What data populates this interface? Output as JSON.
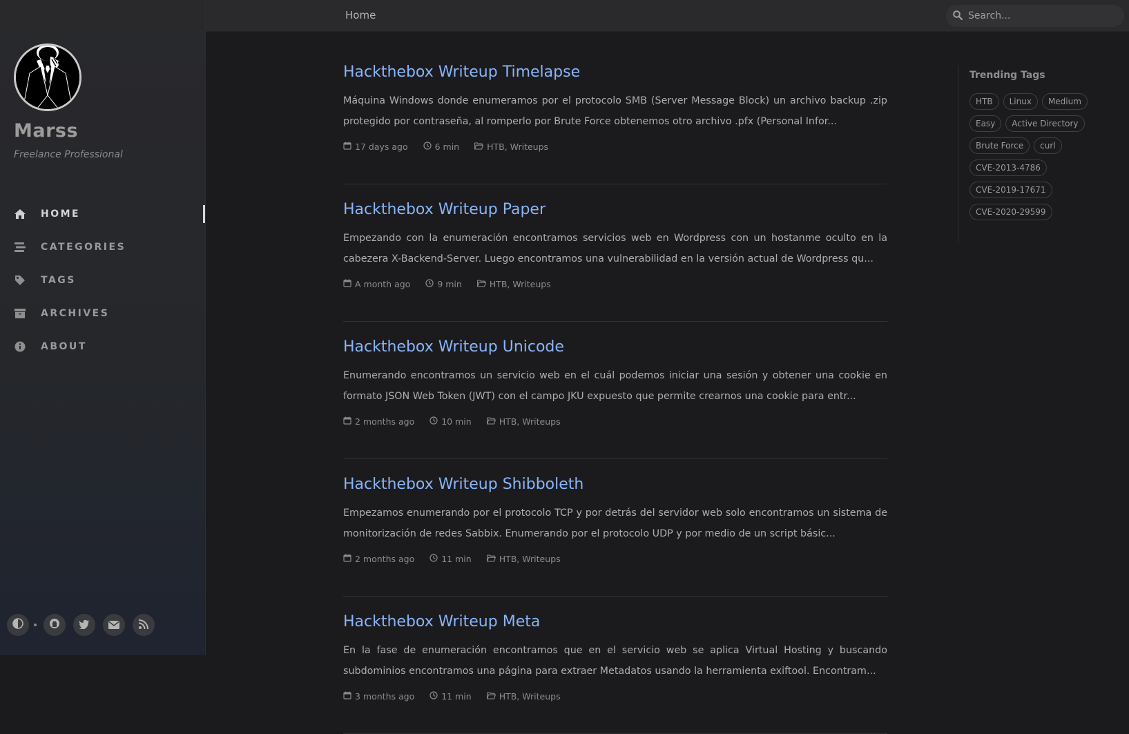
{
  "sidebar": {
    "title": "Marss",
    "subtitle": "Freelance Professional",
    "nav": [
      {
        "label": "HOME",
        "icon": "home-icon",
        "active": true
      },
      {
        "label": "CATEGORIES",
        "icon": "stream-icon",
        "active": false
      },
      {
        "label": "TAGS",
        "icon": "tag-icon",
        "active": false
      },
      {
        "label": "ARCHIVES",
        "icon": "archive-icon",
        "active": false
      },
      {
        "label": "ABOUT",
        "icon": "info-circle-icon",
        "active": false
      }
    ],
    "bottom_icons": [
      "theme-toggle-icon",
      "github-icon",
      "twitter-icon",
      "email-icon",
      "rss-icon"
    ]
  },
  "topbar": {
    "breadcrumb": "Home",
    "search_placeholder": "Search..."
  },
  "posts": [
    {
      "title": "Hackthebox Writeup Timelapse",
      "excerpt": "Máquina Windows donde enumeramos por el protocolo SMB (Server Message Block) un archivo backup .zip protegido por contraseña, al romperlo por Brute Force obtenemos otro archivo .pfx (Personal Infor...",
      "date": "17 days ago",
      "read_time": "6 min",
      "categories": "HTB, Writeups"
    },
    {
      "title": "Hackthebox Writeup Paper",
      "excerpt": "Empezando con la enumeración encontramos servicios web en Wordpress con un hostanme oculto en la cabezera X-Backend-Server. Luego encontramos una vulnerabilidad en la versión actual de Wordpress qu...",
      "date": "A month ago",
      "read_time": "9 min",
      "categories": "HTB, Writeups"
    },
    {
      "title": "Hackthebox Writeup Unicode",
      "excerpt": "Enumerando encontramos un servicio web en el cuál podemos iniciar una sesión y obtener una cookie en formato JSON Web Token (JWT) con el campo JKU expuesto que permite crearnos una cookie para entr...",
      "date": "2 months ago",
      "read_time": "10 min",
      "categories": "HTB, Writeups"
    },
    {
      "title": "Hackthebox Writeup Shibboleth",
      "excerpt": "Empezamos enumerando por el protocolo TCP y por detrás del servidor web solo encontramos un sistema de monitorización de redes Sabbix. Enumerando por el protocolo UDP y por medio de un script básic...",
      "date": "2 months ago",
      "read_time": "11 min",
      "categories": "HTB, Writeups"
    },
    {
      "title": "Hackthebox Writeup Meta",
      "excerpt": "En la fase de enumeración encontramos que en el servicio web se aplica Virtual Hosting y buscando subdominios encontramos una página para extraer Metadatos usando la herramienta exiftool. Encontram...",
      "date": "3 months ago",
      "read_time": "11 min",
      "categories": "HTB, Writeups"
    }
  ],
  "panel": {
    "heading": "Trending Tags",
    "tags": [
      "HTB",
      "Linux",
      "Medium",
      "Easy",
      "Active Directory",
      "Brute Force",
      "curl",
      "CVE-2013-4786",
      "CVE-2019-17671",
      "CVE-2020-29599"
    ]
  },
  "colors": {
    "link": "#8ab4f8",
    "background": "#1b1b1e",
    "sidebar": "#29292c",
    "topbar": "#2a2a2d"
  }
}
